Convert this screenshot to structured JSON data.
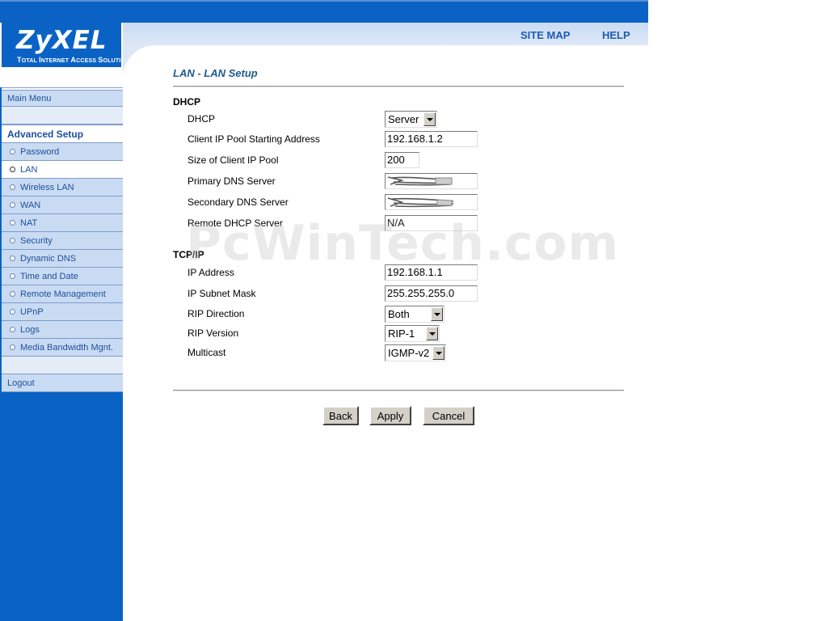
{
  "brand": {
    "name": "ZyXEL",
    "tagline": "Total Internet Access Solution"
  },
  "toplinks": {
    "site_map": "SITE MAP",
    "help": "HELP"
  },
  "sidebar": {
    "main_menu": "Main Menu",
    "heading": "Advanced Setup",
    "items": [
      {
        "label": "Password"
      },
      {
        "label": "LAN",
        "active": true
      },
      {
        "label": "Wireless LAN"
      },
      {
        "label": "WAN"
      },
      {
        "label": "NAT"
      },
      {
        "label": "Security"
      },
      {
        "label": "Dynamic DNS"
      },
      {
        "label": "Time and Date"
      },
      {
        "label": "Remote Management"
      },
      {
        "label": "UPnP"
      },
      {
        "label": "Logs"
      },
      {
        "label": "Media Bandwidth Mgnt."
      }
    ],
    "logout": "Logout"
  },
  "page": {
    "title": "LAN - LAN Setup"
  },
  "dhcp": {
    "section": "DHCP",
    "dhcp_label": "DHCP",
    "dhcp_value": "Server",
    "start_label": "Client IP Pool Starting Address",
    "start_value": "192.168.1.2",
    "pool_label": "Size of Client IP Pool",
    "pool_value": "200",
    "dns1_label": "Primary DNS Server",
    "dns2_label": "Secondary DNS Server",
    "remote_label": "Remote DHCP Server",
    "remote_value": "N/A"
  },
  "tcpip": {
    "section": "TCP/IP",
    "ip_label": "IP Address",
    "ip_value": "192.168.1.1",
    "mask_label": "IP Subnet Mask",
    "mask_value": "255.255.255.0",
    "rip_dir_label": "RIP Direction",
    "rip_dir_value": "Both",
    "rip_ver_label": "RIP Version",
    "rip_ver_value": "RIP-1",
    "multicast_label": "Multicast",
    "multicast_value": "IGMP-v2"
  },
  "buttons": {
    "back": "Back",
    "apply": "Apply",
    "cancel": "Cancel"
  },
  "watermark": "PcWinTech.com",
  "colors": {
    "sidebar_blue": "#0a63c4",
    "menu_light": "#c9dbf3",
    "title_blue": "#1d5b8f"
  }
}
